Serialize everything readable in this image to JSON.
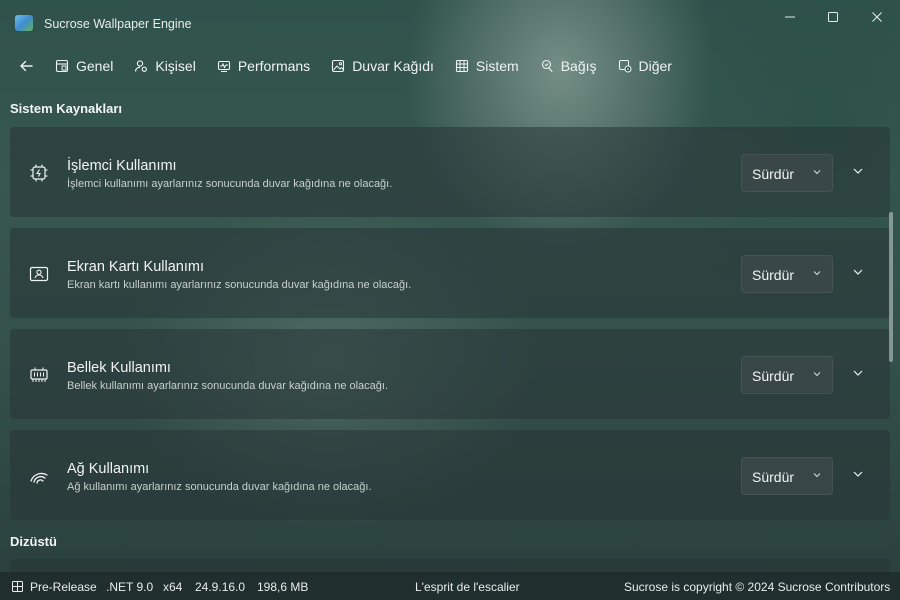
{
  "window": {
    "title": "Sucrose Wallpaper Engine"
  },
  "nav": {
    "tabs": [
      {
        "label": "Genel",
        "icon": "general-icon"
      },
      {
        "label": "Kişisel",
        "icon": "personal-icon"
      },
      {
        "label": "Performans",
        "icon": "performance-icon"
      },
      {
        "label": "Duvar Kağıdı",
        "icon": "wallpaper-icon"
      },
      {
        "label": "Sistem",
        "icon": "system-icon"
      },
      {
        "label": "Bağış",
        "icon": "donate-icon"
      },
      {
        "label": "Diğer",
        "icon": "other-icon"
      }
    ]
  },
  "sections": {
    "system_resources": "Sistem Kaynakları",
    "laptop": "Dizüstü"
  },
  "cards": [
    {
      "title": "İşlemci Kullanımı",
      "desc": "İşlemci kullanımı ayarlarınız sonucunda duvar kağıdına ne olacağı.",
      "value": "Sürdür",
      "icon": "cpu-icon"
    },
    {
      "title": "Ekran Kartı Kullanımı",
      "desc": "Ekran kartı kullanımı ayarlarınız sonucunda duvar kağıdına ne olacağı.",
      "value": "Sürdür",
      "icon": "gpu-icon"
    },
    {
      "title": "Bellek Kullanımı",
      "desc": "Bellek kullanımı ayarlarınız sonucunda duvar kağıdına ne olacağı.",
      "value": "Sürdür",
      "icon": "memory-icon"
    },
    {
      "title": "Ağ Kullanımı",
      "desc": "Ağ kullanımı ayarlarınız sonucunda duvar kağıdına ne olacağı.",
      "value": "Sürdür",
      "icon": "network-icon"
    }
  ],
  "status": {
    "channel": "Pre-Release",
    "framework": ".NET 9.0",
    "arch": "x64",
    "version": "24.9.16.0",
    "memory": "198,6 MB",
    "quote": "L'esprit de l'escalier",
    "copyright": "Sucrose is copyright © 2024 Sucrose Contributors"
  }
}
